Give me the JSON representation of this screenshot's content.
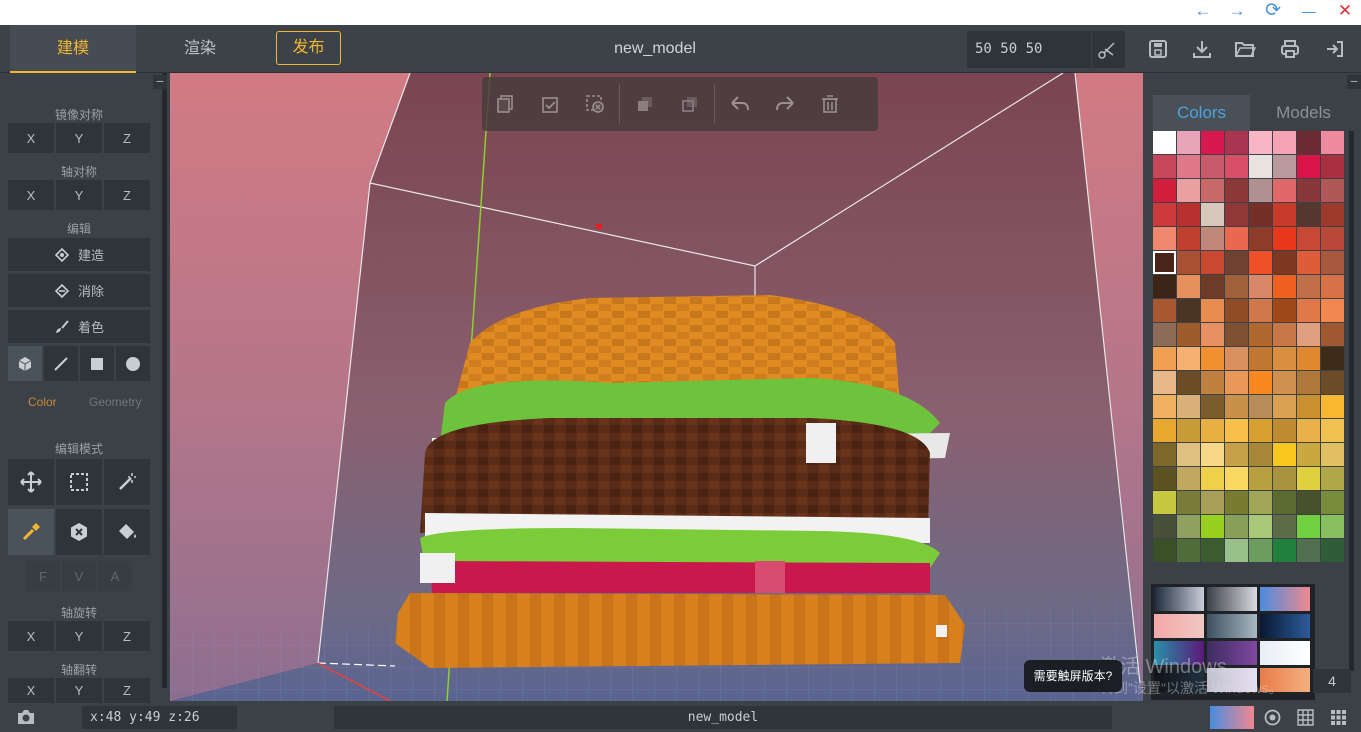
{
  "window": {
    "back_icon": "←",
    "forward_icon": "→",
    "refresh_icon": "⟳",
    "minimize_icon": "—",
    "close_icon": "✕"
  },
  "header": {
    "tabs": [
      {
        "label": "建模",
        "active": true
      },
      {
        "label": "渲染",
        "active": false
      }
    ],
    "publish_label": "发布",
    "model_name": "new_model",
    "size_value": "50 50 50"
  },
  "left_panel": {
    "mirror_label": "镜像对称",
    "axis_sym_label": "轴对称",
    "edit_label": "编辑",
    "build_label": "建造",
    "erase_label": "消除",
    "paint_label": "着色",
    "color_tab": "Color",
    "geometry_tab": "Geometry",
    "edit_mode_label": "编辑模式",
    "fva": [
      "F",
      "V",
      "A"
    ],
    "rotate_label": "轴旋转",
    "flip_label": "轴翻转",
    "axes": [
      "X",
      "Y",
      "Z"
    ]
  },
  "right_panel": {
    "tabs": [
      {
        "label": "Colors",
        "active": true
      },
      {
        "label": "Models",
        "active": false
      }
    ],
    "palette_number": "4",
    "selected_index": 40,
    "swatches": [
      "#ffffff",
      "#e8a4b8",
      "#d8194f",
      "#a8344f",
      "#f8b5c5",
      "#f5a3b5",
      "#6c2a33",
      "#f08a9e",
      "#c8465a",
      "#e0788c",
      "#c85a6c",
      "#d85068",
      "#e8e2e0",
      "#b89a9c",
      "#d81448",
      "#a83040",
      "#d01e3c",
      "#e8a0a0",
      "#c86868",
      "#8c3838",
      "#b09090",
      "#e06868",
      "#883838",
      "#b05858",
      "#cc3a3a",
      "#b83030",
      "#d8c8bc",
      "#903838",
      "#743028",
      "#c83a2a",
      "#543830",
      "#9c3a2c",
      "#f08870",
      "#c04030",
      "#c08878",
      "#e86850",
      "#8c3c28",
      "#e8381c",
      "#c84838",
      "#b84838",
      "#4a2418",
      "#a85034",
      "#c84830",
      "#704030",
      "#f05028",
      "#7c3820",
      "#e05c38",
      "#a8583c",
      "#3c2416",
      "#e8905c",
      "#6c3c28",
      "#a0603c",
      "#d88868",
      "#f06020",
      "#c07048",
      "#d87048",
      "#a85830",
      "#4c3424",
      "#e88c50",
      "#904c24",
      "#d0784c",
      "#a04818",
      "#e07848",
      "#f08850",
      "#8c6c58",
      "#9c5c2c",
      "#e89060",
      "#7c5030",
      "#b06830",
      "#c87848",
      "#e0a080",
      "#a05830",
      "#f0a050",
      "#f8b070",
      "#f09030",
      "#d89060",
      "#c07830",
      "#d89040",
      "#e08830",
      "#3c2c18",
      "#e8b888",
      "#6c4c24",
      "#c08040",
      "#e89858",
      "#f88820",
      "#d09050",
      "#b07838",
      "#6c4c28",
      "#f0b060",
      "#d8b078",
      "#7c5c2c",
      "#c89048",
      "#b88c58",
      "#d8a050",
      "#c89030",
      "#f8b830",
      "#e8a830",
      "#c89c38",
      "#e8b040",
      "#f8c048",
      "#d8a030",
      "#c08c30",
      "#e8b048",
      "#f0c050",
      "#7c6828",
      "#e0c080",
      "#f8d888",
      "#c8a048",
      "#a88838",
      "#f8c820",
      "#c8a840",
      "#e0c060",
      "#5c5420",
      "#c0a860",
      "#f0d048",
      "#f8d860",
      "#b8a040",
      "#a89440",
      "#e0d040",
      "#b0a848",
      "#c8c840",
      "#787c38",
      "#a8a058",
      "#787c30",
      "#a0a858",
      "#5c6c30",
      "#48502c",
      "#788c3c",
      "#485038",
      "#90a060",
      "#98d020",
      "#88a058",
      "#a8c878",
      "#5c6c48",
      "#70d040",
      "#88c060",
      "#3c5028",
      "#506c38",
      "#3c5c30",
      "#98c088",
      "#6c9c60",
      "#20803c",
      "#507050",
      "#305c38"
    ],
    "gradients": [
      [
        "#1e2a3c",
        "#c8cdd8"
      ],
      [
        "#3c4048",
        "#d8dce0"
      ],
      [
        "#4a8ce0",
        "#f08890"
      ],
      [
        "#f4a7a8",
        "#f0c8c0"
      ],
      [
        "#3c5060",
        "#a8b8c0"
      ],
      [
        "#0a1830",
        "#2c5c9c"
      ],
      [
        "#2890a8",
        "#5c1878"
      ],
      [
        "#3c2c60",
        "#8048a0"
      ],
      [
        "#e8eef4",
        "#ffffff"
      ],
      [
        "#101418",
        "#203040"
      ],
      [
        "#c0c0d0",
        "#e8e0f0"
      ],
      [
        "#e87c48",
        "#f4b080"
      ]
    ]
  },
  "viewport": {
    "toolbar_icons": [
      "copy-icon",
      "paste-icon",
      "clear-selection-icon",
      "group-icon",
      "ungroup-icon",
      "undo-icon",
      "redo-icon",
      "delete-icon"
    ]
  },
  "overlay": {
    "tooltip": "需要触屏版本?",
    "activate_title": "激活 Windows",
    "activate_sub": "转到\"设置\"以激活 Windows。"
  },
  "status": {
    "coords": "x:48  y:49  z:26",
    "name": "new_model"
  }
}
